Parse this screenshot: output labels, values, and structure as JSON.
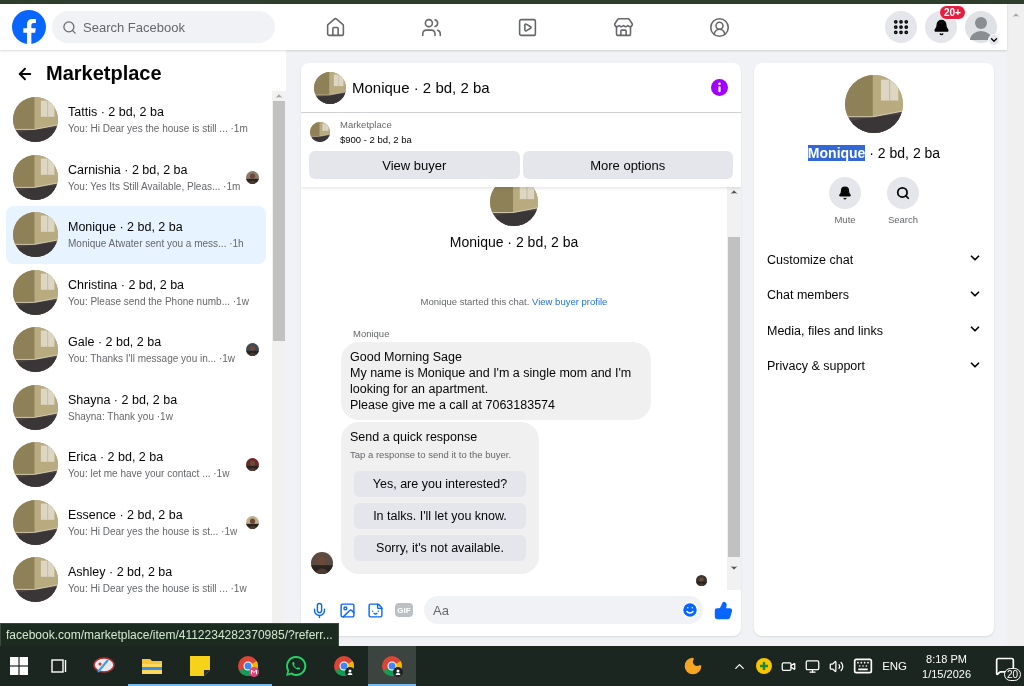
{
  "nav": {
    "search": {
      "placeholder": "Search Facebook"
    },
    "tabs": [
      {
        "kind": "home",
        "selected": false
      },
      {
        "kind": "friends",
        "selected": false
      },
      {
        "kind": "video",
        "selected": false
      },
      {
        "kind": "marketplace",
        "selected": false
      },
      {
        "kind": "groups",
        "selected": false
      }
    ],
    "notifications_badge": "20+"
  },
  "sidebar": {
    "title": "Marketplace",
    "conversations": [
      {
        "title": "Tattis · 2 bd, 2 ba",
        "preview": "You: Hi Dear yes the house is still ...",
        "time": "·1m",
        "selected": false,
        "seen_by": false
      },
      {
        "title": "Carnishia · 2 bd, 2 ba",
        "preview": "You: Yes Its Still Available, Pleas...",
        "time": "·1m",
        "selected": false,
        "seen_by": true
      },
      {
        "title": "Monique · 2 bd, 2 ba",
        "preview": "Monique Atwater sent you a mess...",
        "time": "·1h",
        "selected": true,
        "seen_by": false
      },
      {
        "title": "Christina · 2 bd, 2 ba",
        "preview": "You: Please send the Phone numb...",
        "time": "·1w",
        "selected": false,
        "seen_by": false
      },
      {
        "title": "Gale · 2 bd, 2 ba",
        "preview": "You: Thanks I'll message you in...",
        "time": "·1w",
        "selected": false,
        "seen_by": true
      },
      {
        "title": "Shayna · 2 bd, 2 ba",
        "preview": "Shayna: Thank you",
        "time": "·1w",
        "selected": false,
        "seen_by": false
      },
      {
        "title": "Erica · 2 bd, 2 ba",
        "preview": "You: let me have your contact ...",
        "time": "·1w",
        "selected": false,
        "seen_by": true
      },
      {
        "title": "Essence · 2 bd, 2 ba",
        "preview": "You: Hi Dear yes the house is st...",
        "time": "·1w",
        "selected": false,
        "seen_by": true
      },
      {
        "title": "Ashley · 2 bd, 2 ba",
        "preview": "You: Hi Dear yes the house is still ...",
        "time": "·1w",
        "selected": false,
        "seen_by": false
      }
    ]
  },
  "chat": {
    "title": "Monique · 2 bd, 2 ba",
    "listing": {
      "label": "Marketplace",
      "price": "$900 - 2 bd, 2 ba"
    },
    "actions": [
      "View buyer",
      "More options"
    ],
    "intro": {
      "title": "Monique · 2 bd, 2 ba",
      "note": "Monique started this chat.",
      "link": "View buyer profile"
    },
    "sender": "Monique",
    "message_lines": [
      "Good Morning Sage",
      "My name is Monique and I'm a single mom and I'm",
      "looking for an apartment.",
      "Please give me a call at 7063183574"
    ],
    "quick_response": {
      "title": "Send a quick response",
      "hint": "Tap a response to send it to the buyer.",
      "options": [
        "Yes, are you interested?",
        "In talks. I'll let you know.",
        "Sorry, it's not available."
      ]
    },
    "composer": {
      "gif_label": "GIF",
      "placeholder": "Aa"
    }
  },
  "details": {
    "name": "Monique",
    "name_selected": true,
    "suffix": "· 2 bd, 2 ba",
    "actions": [
      {
        "kind": "mute",
        "label": "Mute"
      },
      {
        "kind": "search",
        "label": "Search"
      }
    ],
    "sections": [
      {
        "label": "Customize chat",
        "expanded": false
      },
      {
        "label": "Chat members",
        "expanded": false
      },
      {
        "label": "Media, files and links",
        "expanded": false
      },
      {
        "label": "Privacy & support",
        "expanded": false
      }
    ]
  },
  "link_preview": "facebook.com/marketplace/item/4112234282370985/?referr...",
  "taskbar": {
    "apps": [
      {
        "kind": "paint",
        "running": false,
        "selected": false
      },
      {
        "kind": "explorer",
        "running": true,
        "selected": false
      },
      {
        "kind": "notes",
        "running": true,
        "selected": false
      },
      {
        "kind": "chrome-m",
        "running": true,
        "selected": false
      },
      {
        "kind": "whatsapp",
        "running": false,
        "selected": false
      },
      {
        "kind": "chrome",
        "running": false,
        "selected": false
      },
      {
        "kind": "chrome-user",
        "running": true,
        "selected": true
      }
    ],
    "language": "ENG",
    "time": "8:18 PM",
    "date": "1/15/2026",
    "notification_count": "20"
  }
}
